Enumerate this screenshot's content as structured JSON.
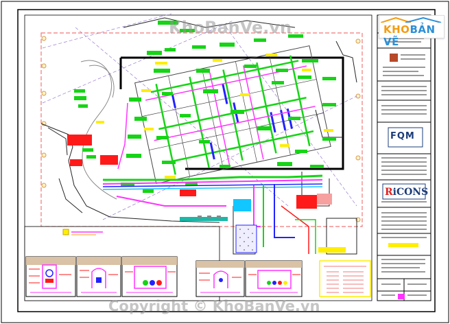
{
  "watermark": {
    "top": "KhoBanVe.vn",
    "bottom": "Copyright © KhoBanVe.vn"
  },
  "brand": {
    "part1": "KHO",
    "part2": "BẢN VẼ"
  },
  "title_block": {
    "logo_fqm": "FQM",
    "logo_ricons_r": "R",
    "logo_ricons_rest": "iCONS"
  },
  "colors": {
    "accent_green": "#16d416",
    "accent_red": "#ff1a1a",
    "accent_magenta": "#ff33ff",
    "accent_blue": "#2222ff",
    "accent_cyan": "#12c6ff",
    "accent_yellow": "#ffee00",
    "dashed_boundary": "#f07878"
  }
}
